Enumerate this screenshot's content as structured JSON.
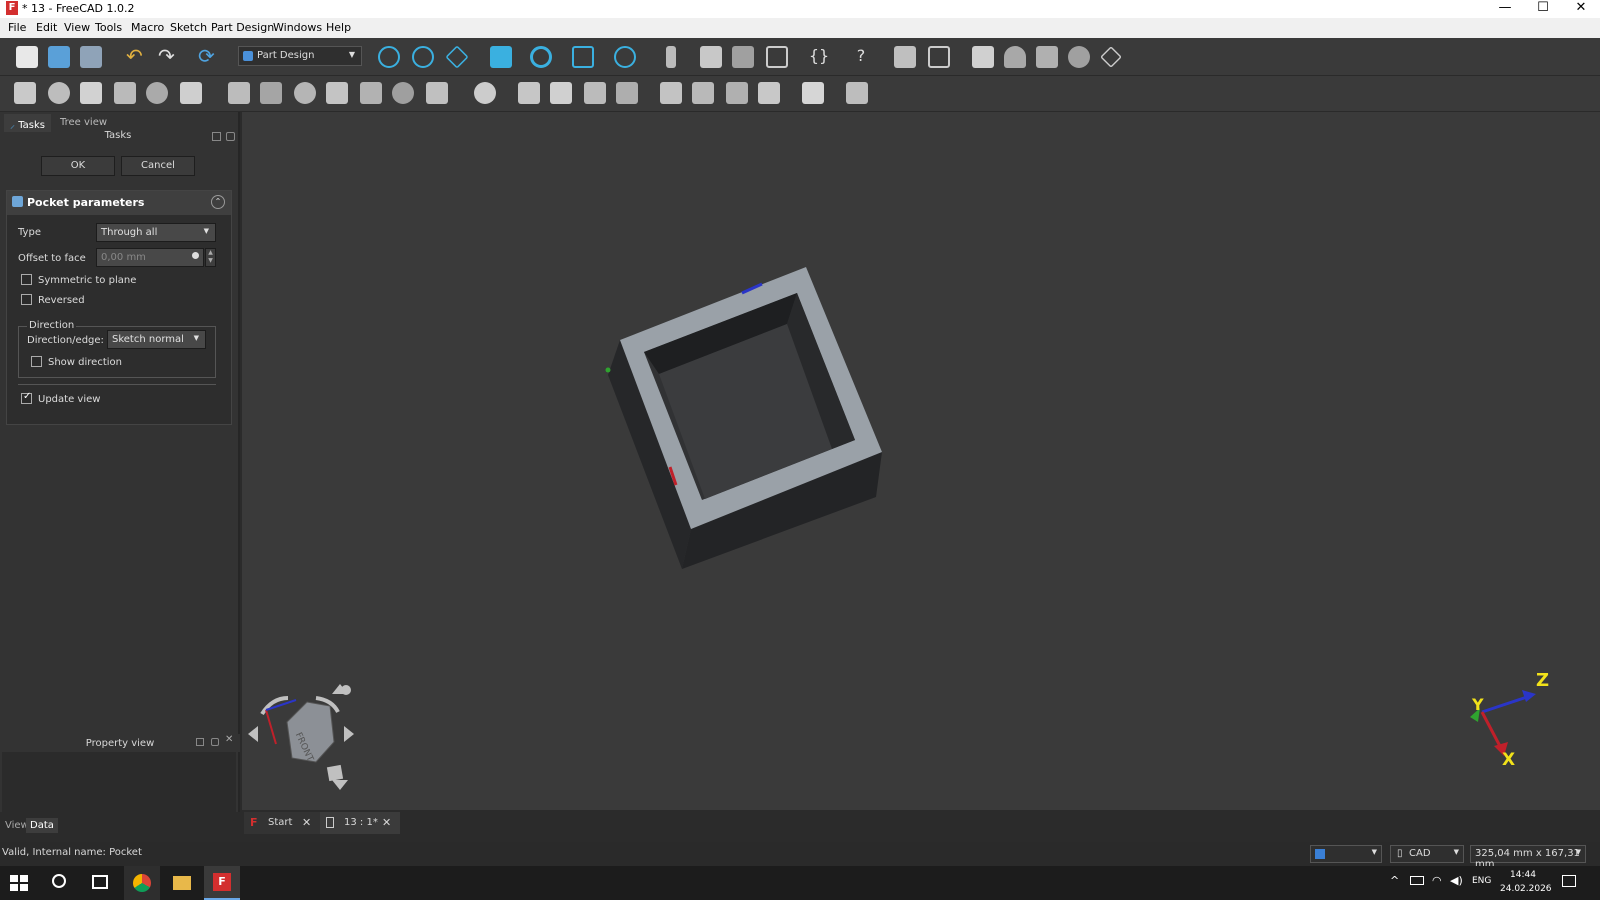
{
  "window": {
    "title": "* 13 - FreeCAD 1.0.2",
    "app_icon": "freecad-logo-icon",
    "minimize": "—",
    "maximize": "☐",
    "close": "✕"
  },
  "menu": [
    "File",
    "Edit",
    "View",
    "Tools",
    "Macro",
    "Sketch",
    "Part Design",
    "Windows",
    "Help"
  ],
  "toolbar": {
    "workbench": "Part Design"
  },
  "tabs": {
    "tasks": "Tasks",
    "tree": "Tree view"
  },
  "tasks_panel": {
    "title": "Tasks",
    "ok": "OK",
    "cancel": "Cancel"
  },
  "pocket": {
    "title": "Pocket parameters",
    "type_label": "Type",
    "type_value": "Through all",
    "offset_label": "Offset to face",
    "offset_value": "0,00 mm",
    "symmetric_label": "Symmetric to plane",
    "symmetric_checked": false,
    "reversed_label": "Reversed",
    "reversed_checked": false,
    "direction_group": "Direction",
    "direction_label": "Direction/edge:",
    "direction_value": "Sketch normal",
    "show_direction_label": "Show direction",
    "show_direction_checked": false,
    "update_view_label": "Update view",
    "update_view_checked": true
  },
  "property_view": {
    "title": "Property view",
    "tab_view": "View",
    "tab_data": "Data"
  },
  "navcube": {
    "face": "FRONT"
  },
  "axes": {
    "x": "X",
    "y": "Y",
    "z": "Z"
  },
  "doc_tabs": [
    {
      "label": "Start"
    },
    {
      "label": "13 : 1*"
    }
  ],
  "status": {
    "message": "Valid, Internal name: Pocket",
    "nav_style": "CAD",
    "dimensions": "325,04 mm x 167,31 mm"
  },
  "taskbar": {
    "lang": "ENG",
    "time": "14:44",
    "date": "24.02.2026"
  },
  "colors": {
    "background": "#3a3a3a",
    "part_face": "#9aa1a8",
    "part_side": "#2b2c2e"
  }
}
